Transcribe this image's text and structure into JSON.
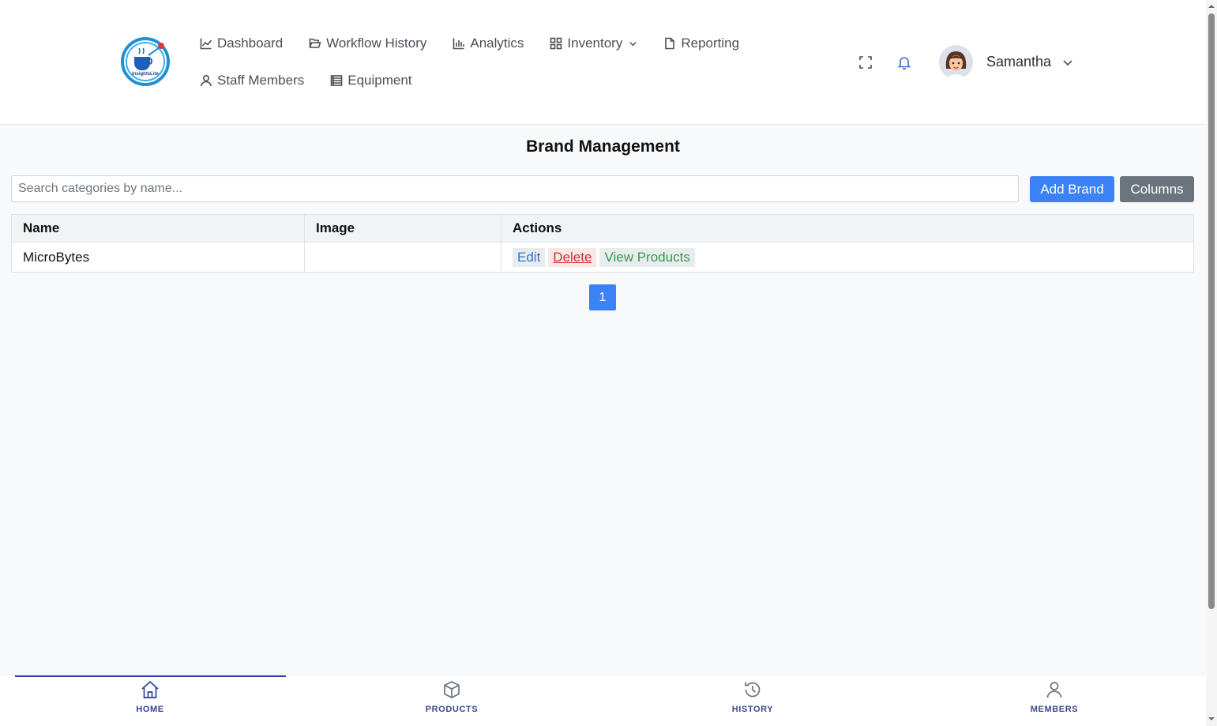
{
  "header": {
    "logo_text": "InsightsLite",
    "nav_row1": [
      {
        "label": "Dashboard",
        "icon": "chart-line-icon"
      },
      {
        "label": "Workflow History",
        "icon": "folder-icon"
      },
      {
        "label": "Analytics",
        "icon": "bar-chart-icon"
      },
      {
        "label": "Inventory",
        "icon": "grid-icon",
        "has_dropdown": true
      },
      {
        "label": "Reporting",
        "icon": "document-icon"
      }
    ],
    "nav_row2": [
      {
        "label": "Staff Members",
        "icon": "user-icon"
      },
      {
        "label": "Equipment",
        "icon": "list-icon"
      }
    ],
    "user": {
      "name": "Samantha"
    }
  },
  "main": {
    "title": "Brand Management",
    "search_placeholder": "Search categories by name...",
    "add_button": "Add Brand",
    "columns_button": "Columns",
    "table": {
      "headers": [
        "Name",
        "Image",
        "Actions"
      ],
      "rows": [
        {
          "name": "MicroBytes",
          "image": "",
          "actions": [
            "Edit",
            "Delete",
            "View Products"
          ]
        }
      ]
    },
    "pagination": {
      "current_page": "1"
    }
  },
  "bottom_nav": {
    "items": [
      {
        "label": "HOME",
        "icon": "home-icon",
        "active": true
      },
      {
        "label": "PRODUCTS",
        "icon": "box-icon"
      },
      {
        "label": "HISTORY",
        "icon": "history-icon"
      },
      {
        "label": "MEMBERS",
        "icon": "user-icon"
      }
    ]
  },
  "colors": {
    "primary": "#3b82f6",
    "secondary": "#6c757d",
    "nav_active": "#2f3f9f",
    "nav_inactive": "#3d4a8f",
    "delete": "#d32f2f",
    "view": "#2e9e48"
  }
}
